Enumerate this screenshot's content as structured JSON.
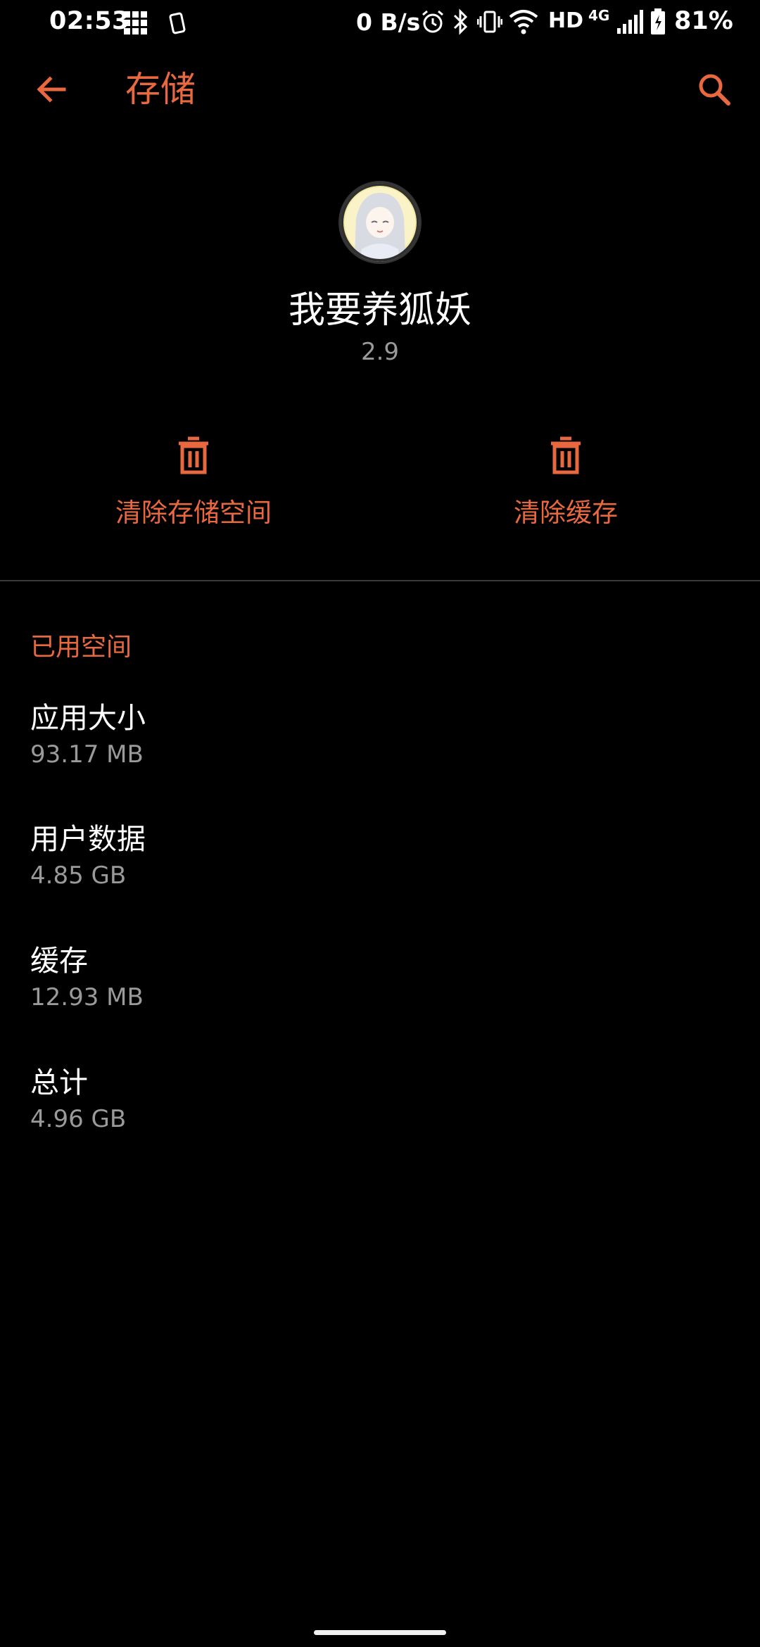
{
  "status_bar": {
    "time": "02:53",
    "network_speed": "0 B/s",
    "hd_label": "HD",
    "network_type": "4G",
    "battery": "81%"
  },
  "toolbar": {
    "title": "存储",
    "back_icon": "arrow-back-icon",
    "search_icon": "search-icon"
  },
  "app": {
    "name": "我要养狐妖",
    "version": "2.9"
  },
  "actions": {
    "clear_storage_label": "清除存储空间",
    "clear_cache_label": "清除缓存"
  },
  "section": {
    "header": "已用空间"
  },
  "rows": [
    {
      "title": "应用大小",
      "value": "93.17 MB"
    },
    {
      "title": "用户数据",
      "value": "4.85 GB"
    },
    {
      "title": "缓存",
      "value": "12.93 MB"
    },
    {
      "title": "总计",
      "value": "4.96 GB"
    }
  ],
  "colors": {
    "accent": "#E8683F",
    "background": "#000000",
    "secondary_text": "#9a9a9a"
  }
}
